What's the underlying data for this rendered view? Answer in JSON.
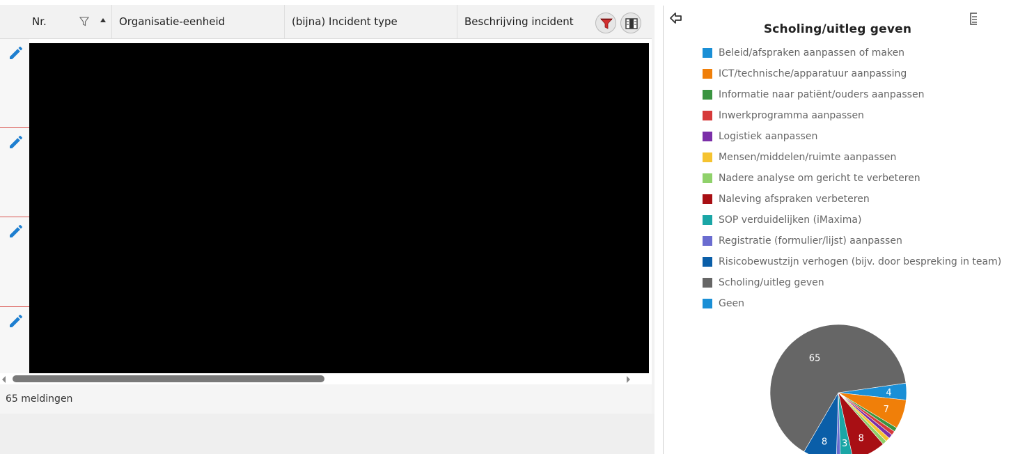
{
  "grid": {
    "columns": [
      {
        "key": "nr",
        "label": "Nr."
      },
      {
        "key": "org",
        "label": "Organisatie-eenheid"
      },
      {
        "key": "type",
        "label": "(bijna) Incident type"
      },
      {
        "key": "desc",
        "label": "Beschrijving incident"
      }
    ],
    "footer_count": "65 meldingen"
  },
  "colors": {
    "edit": "#1e7fd0",
    "filter_funnel": "#d22f2f",
    "row_separator": "#d9534f"
  },
  "chart_panel": {
    "title": "Scholing/uitleg geven"
  },
  "chart_data": {
    "type": "pie",
    "title": "Scholing/uitleg geven",
    "legend_position": "top",
    "categories": [
      "Beleid/afspraken aanpassen of maken",
      "ICT/technische/apparatuur aanpassing",
      "Informatie naar patiënt/ouders aanpassen",
      "Inwerkprogramma aanpassen",
      "Logistiek aanpassen",
      "Mensen/middelen/ruimte aanpassen",
      "Nadere analyse om gericht te verbeteren",
      "Naleving afspraken verbeteren",
      "SOP verduidelijken (iMaxima)",
      "Registratie (formulier/lijst) aanpassen",
      "Risicobewustzijn verhogen (bijv. door bespreking in team)",
      "Scholing/uitleg geven",
      "Geen"
    ],
    "colors": [
      "#1a8fd6",
      "#f07f09",
      "#3a9440",
      "#d63a3a",
      "#7b2fa8",
      "#f5c330",
      "#8fd16a",
      "#a80f14",
      "#1aa6a6",
      "#6a6cd0",
      "#0a5ea8",
      "#666666",
      "#1a8fd6"
    ],
    "values": [
      4,
      7,
      1,
      1,
      1,
      1,
      1,
      8,
      3,
      1,
      8,
      65,
      0
    ],
    "data_labels": [
      "4",
      "7",
      "",
      "",
      "",
      "",
      "",
      "8",
      "3",
      "",
      "8",
      "65",
      ""
    ]
  }
}
